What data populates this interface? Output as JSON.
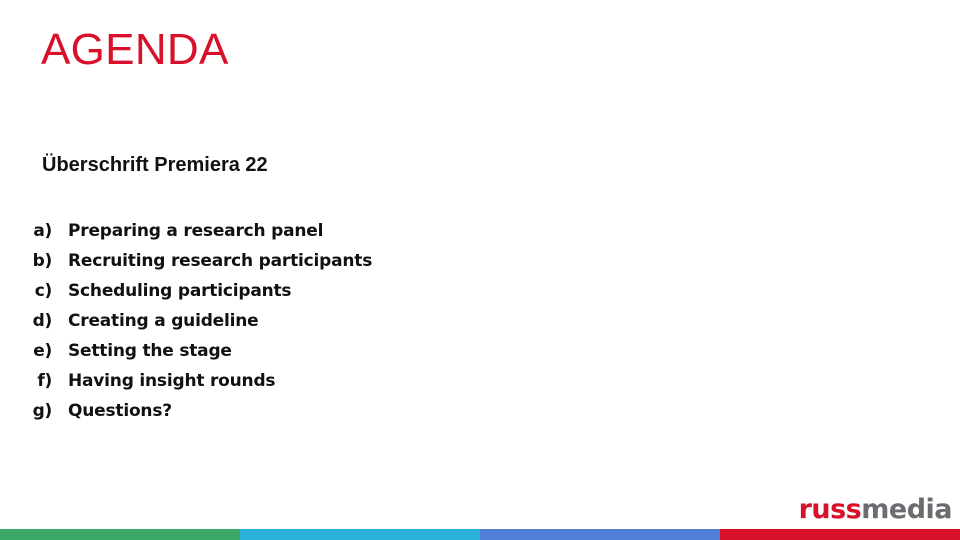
{
  "slide": {
    "title": "AGENDA",
    "subtitle": "Überschrift Premiera 22",
    "items": [
      {
        "marker": "a)",
        "text": "Preparing a research panel"
      },
      {
        "marker": "b)",
        "text": "Recruiting research participants"
      },
      {
        "marker": "c)",
        "text": "Scheduling participants"
      },
      {
        "marker": "d)",
        "text": "Creating a guideline"
      },
      {
        "marker": "e)",
        "text": "Setting the stage"
      },
      {
        "marker": "f)",
        "text": "Having insight rounds"
      },
      {
        "marker": "g)",
        "text": "Questions?"
      }
    ]
  },
  "logo": {
    "part1": "russ",
    "part2": "media"
  },
  "colors": {
    "title": "#d7112a",
    "logo_red": "#d7112a",
    "logo_gray": "#6a6c70",
    "bar_segments": [
      "#3aa766",
      "#2bb0d8",
      "#4f7fd6",
      "#d7112a"
    ]
  }
}
